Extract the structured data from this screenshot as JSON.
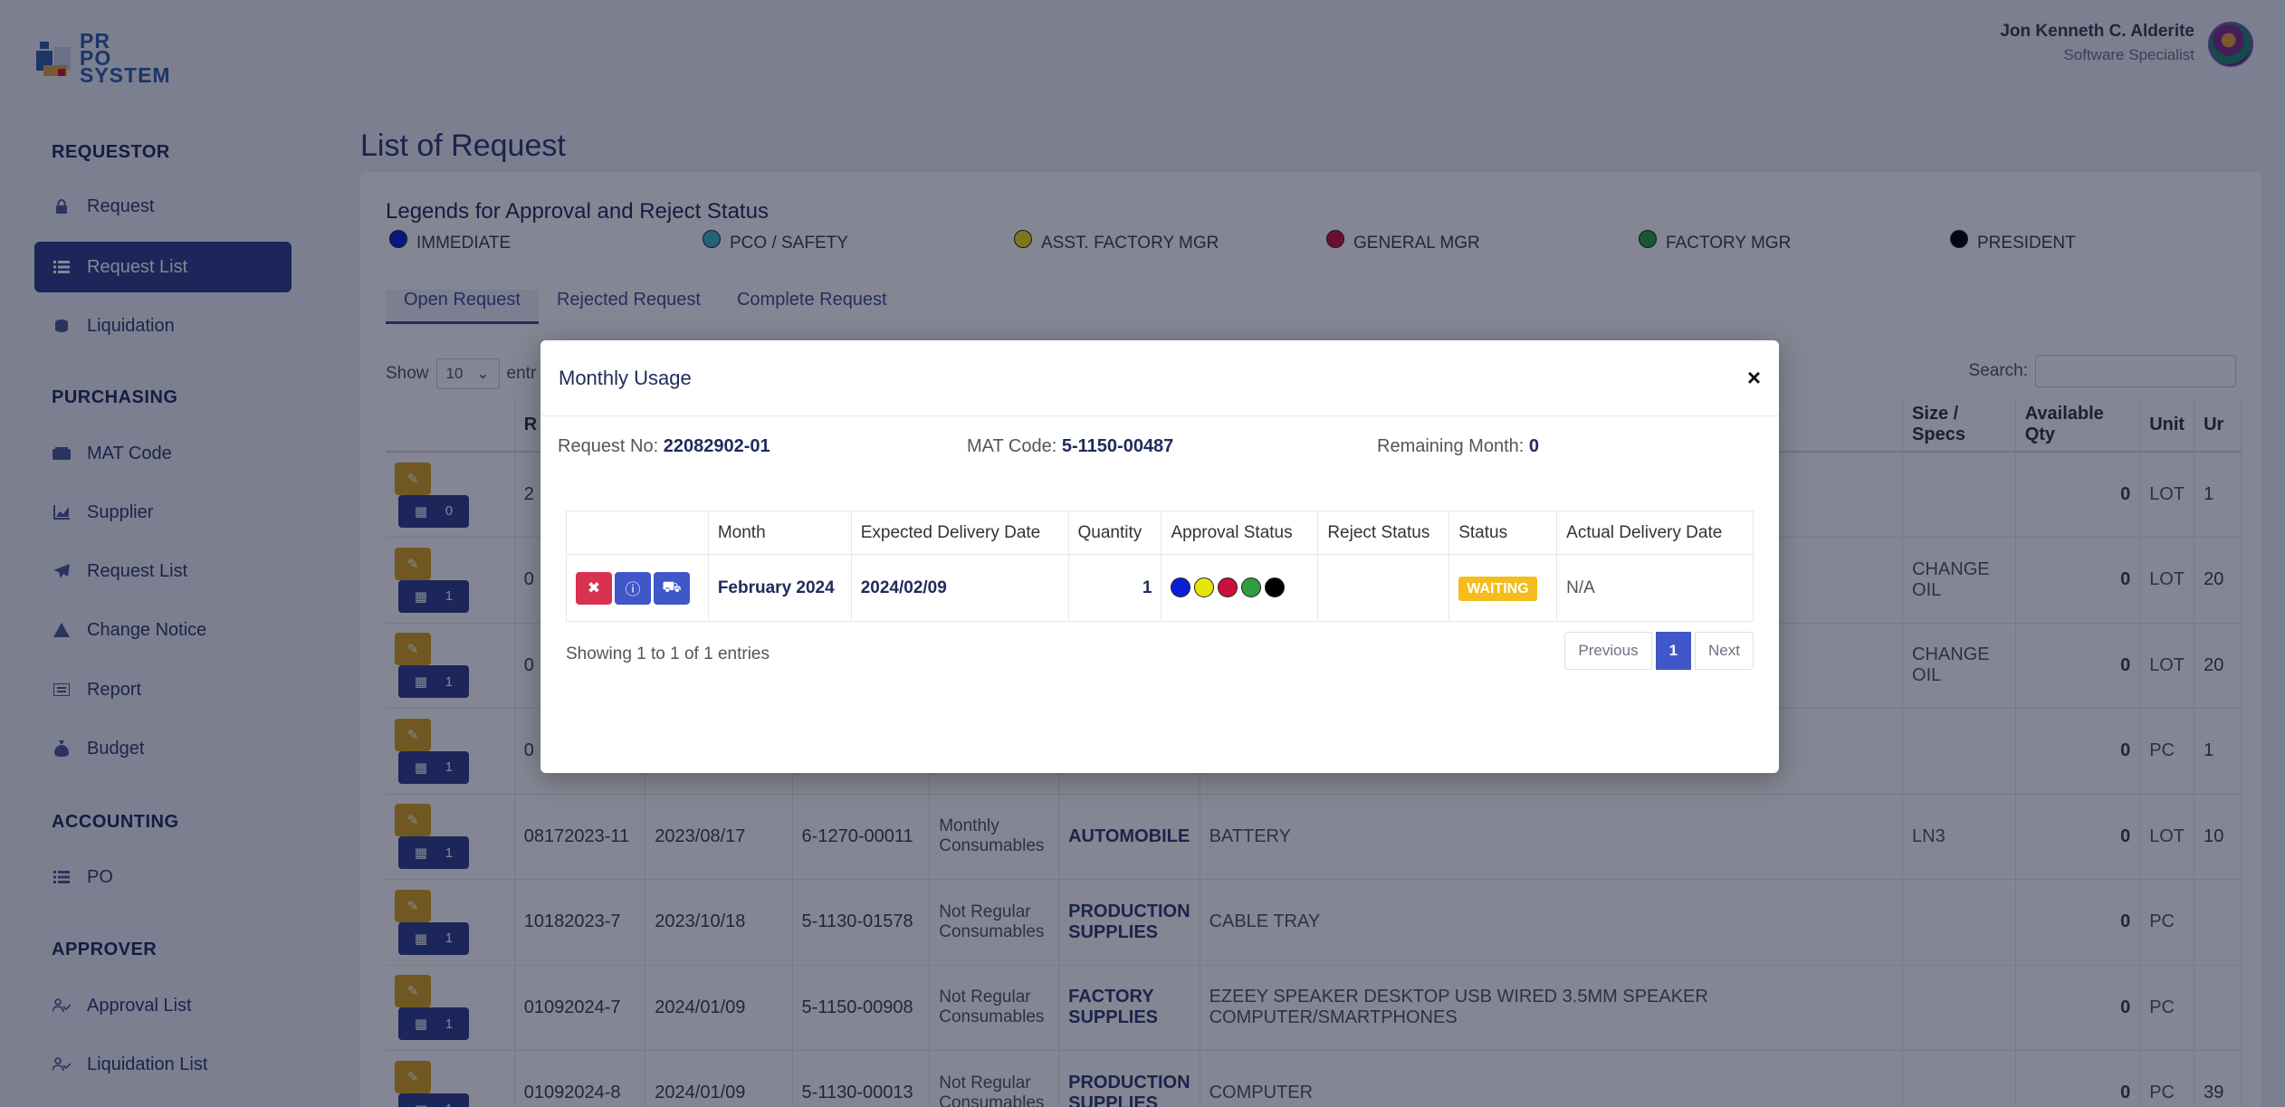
{
  "logo": {
    "line1": "PR",
    "line2": "PO",
    "line3": "SYSTEM"
  },
  "user": {
    "name": "Jon Kenneth C. Alderite",
    "role": "Software Specialist"
  },
  "sidebar": {
    "requestor": {
      "title": "REQUESTOR",
      "items": [
        {
          "label": "Request"
        },
        {
          "label": "Request List"
        },
        {
          "label": "Liquidation"
        }
      ]
    },
    "purchasing": {
      "title": "PURCHASING",
      "items": [
        {
          "label": "MAT Code"
        },
        {
          "label": "Supplier"
        },
        {
          "label": "Request List"
        },
        {
          "label": "Change Notice"
        },
        {
          "label": "Report"
        },
        {
          "label": "Budget"
        }
      ]
    },
    "accounting": {
      "title": "ACCOUNTING",
      "items": [
        {
          "label": "PO"
        }
      ]
    },
    "approver": {
      "title": "APPROVER",
      "items": [
        {
          "label": "Approval List"
        },
        {
          "label": "Liquidation List"
        }
      ]
    }
  },
  "page": {
    "title": "List of Request"
  },
  "legend": {
    "title": "Legends for Approval and Reject Status",
    "items": [
      {
        "label": "IMMEDIATE",
        "color": "#0a1fd6"
      },
      {
        "label": "PCO / SAFETY",
        "color": "#3fb6c6"
      },
      {
        "label": "ASST. FACTORY MGR",
        "color": "#e6e60a"
      },
      {
        "label": "GENERAL MGR",
        "color": "#c8123a"
      },
      {
        "label": "FACTORY MGR",
        "color": "#2e9e3e"
      },
      {
        "label": "PRESIDENT",
        "color": "#000000"
      }
    ]
  },
  "tabs": [
    {
      "label": "Open Request"
    },
    {
      "label": "Rejected Request"
    },
    {
      "label": "Complete Request"
    }
  ],
  "list_controls": {
    "show_label": "Show",
    "entries_value": "10",
    "entries_suffix": "entr",
    "search_label": "Search:"
  },
  "table": {
    "headers": {
      "req": "R",
      "size": "Size / Specs",
      "avail": "Available Qty",
      "unit": "Unit",
      "unitcost": "Ur"
    },
    "rows": [
      {
        "count": "0",
        "req": "2",
        "date": "",
        "mat": "",
        "cat": "",
        "dept": "",
        "desc": "",
        "size": "",
        "avail": "0",
        "unit": "LOT",
        "extra": "1"
      },
      {
        "count": "1",
        "req": "0",
        "date": "",
        "mat": "",
        "cat": "",
        "dept": "",
        "desc": "",
        "size": "CHANGE OIL",
        "avail": "0",
        "unit": "LOT",
        "extra": "20"
      },
      {
        "count": "1",
        "req": "0",
        "date": "",
        "mat": "",
        "cat": "",
        "dept": "",
        "desc": "",
        "size": "CHANGE OIL",
        "avail": "0",
        "unit": "LOT",
        "extra": "20"
      },
      {
        "count": "1",
        "req": "0",
        "date": "",
        "mat": "",
        "cat": "",
        "dept": "",
        "desc": "",
        "size": "",
        "avail": "0",
        "unit": "PC",
        "extra": "1"
      },
      {
        "count": "1",
        "req": "08172023-11",
        "date": "2023/08/17",
        "mat": "6-1270-00011",
        "cat": "Monthly Consumables",
        "dept": "AUTOMOBILE",
        "desc": "BATTERY",
        "size": "LN3",
        "avail": "0",
        "unit": "LOT",
        "extra": "10"
      },
      {
        "count": "1",
        "req": "10182023-7",
        "date": "2023/10/18",
        "mat": "5-1130-01578",
        "cat": "Not Regular Consumables",
        "dept": "PRODUCTION SUPPLIES",
        "desc": "CABLE TRAY",
        "size": "",
        "avail": "0",
        "unit": "PC",
        "extra": ""
      },
      {
        "count": "1",
        "req": "01092024-7",
        "date": "2024/01/09",
        "mat": "5-1150-00908",
        "cat": "Not Regular Consumables",
        "dept": "FACTORY SUPPLIES",
        "desc": "EZEEY SPEAKER DESKTOP USB WIRED 3.5MM SPEAKER COMPUTER/SMARTPHONES",
        "size": "",
        "avail": "0",
        "unit": "PC",
        "extra": ""
      },
      {
        "count": "1",
        "req": "01092024-8",
        "date": "2024/01/09",
        "mat": "5-1130-00013",
        "cat": "Not Regular Consumables",
        "dept": "PRODUCTION SUPPLIES",
        "desc": "COMPUTER",
        "size": "",
        "avail": "0",
        "unit": "PC",
        "extra": "39"
      }
    ]
  },
  "modal": {
    "title": "Monthly Usage",
    "close_glyph": "×",
    "request_no_label": "Request No:",
    "request_no": "22082902-01",
    "mat_code_label": "MAT Code:",
    "mat_code": "5-1150-00487",
    "remaining_label": "Remaining Month:",
    "remaining": "0",
    "columns": {
      "blank": "",
      "month": "Month",
      "expected": "Expected Delivery Date",
      "qty": "Quantity",
      "approval": "Approval Status",
      "reject": "Reject Status",
      "status": "Status",
      "actual": "Actual Delivery Date"
    },
    "row": {
      "month": "February 2024",
      "expected": "2024/02/09",
      "qty": "1",
      "approval_colors": [
        "#0a1fd6",
        "#e6e60a",
        "#c8123a",
        "#2e9e3e",
        "#000000"
      ],
      "reject": "",
      "status": "WAITING",
      "actual": "N/A"
    },
    "showing": "Showing 1 to 1 of 1 entries",
    "pager": {
      "prev": "Previous",
      "current": "1",
      "next": "Next"
    }
  }
}
